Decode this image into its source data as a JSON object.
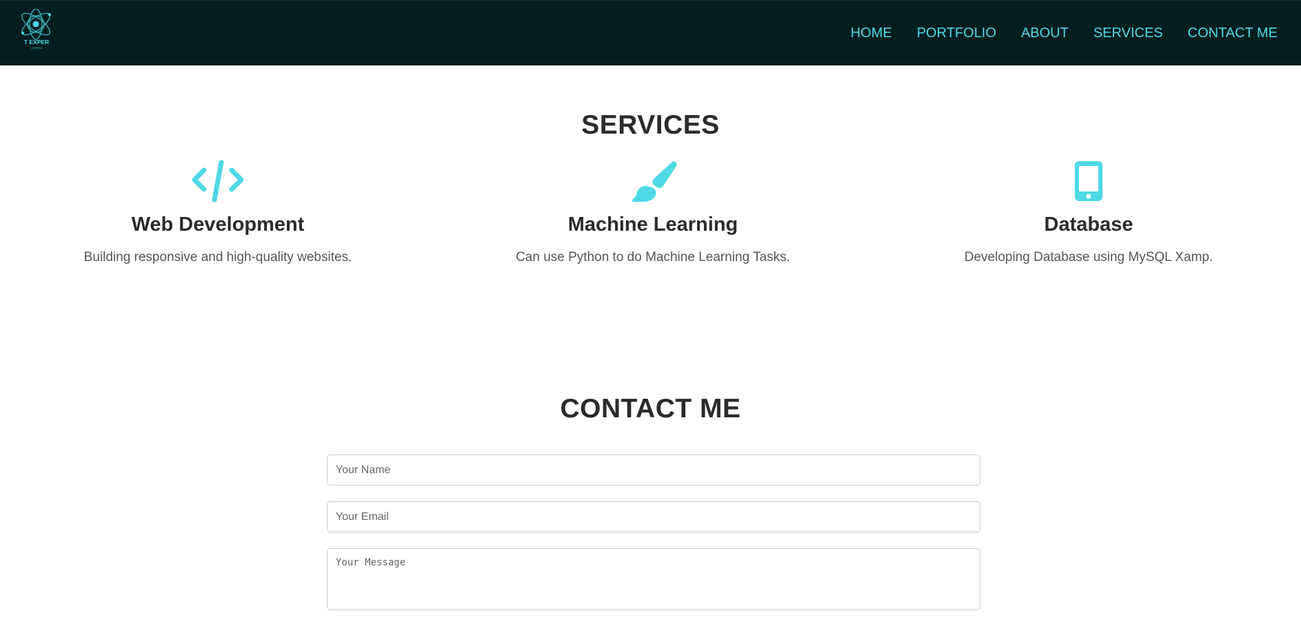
{
  "header": {
    "logo_text": "T EXPER",
    "logo_subtext": "COMPANY",
    "nav": [
      {
        "label": "HOME"
      },
      {
        "label": "PORTFOLIO"
      },
      {
        "label": "ABOUT"
      },
      {
        "label": "SERVICES"
      },
      {
        "label": "CONTACT ME"
      }
    ],
    "colors": {
      "background": "#021e1e",
      "accent": "#4fd8e5"
    }
  },
  "services": {
    "title": "SERVICES",
    "items": [
      {
        "icon": "code-icon",
        "title": "Web Development",
        "description": "Building responsive and high-quality websites."
      },
      {
        "icon": "paint-brush-icon",
        "title": "Machine Learning",
        "description": "Can use Python to do Machine Learning Tasks."
      },
      {
        "icon": "mobile-phone-icon",
        "title": "Database",
        "description": "Developing Database using MySQL Xamp."
      }
    ],
    "icon_color": "#4fd8e5"
  },
  "contact": {
    "title": "CONTACT ME",
    "name_placeholder": "Your Name",
    "email_placeholder": "Your Email",
    "message_placeholder": "Your Message"
  }
}
